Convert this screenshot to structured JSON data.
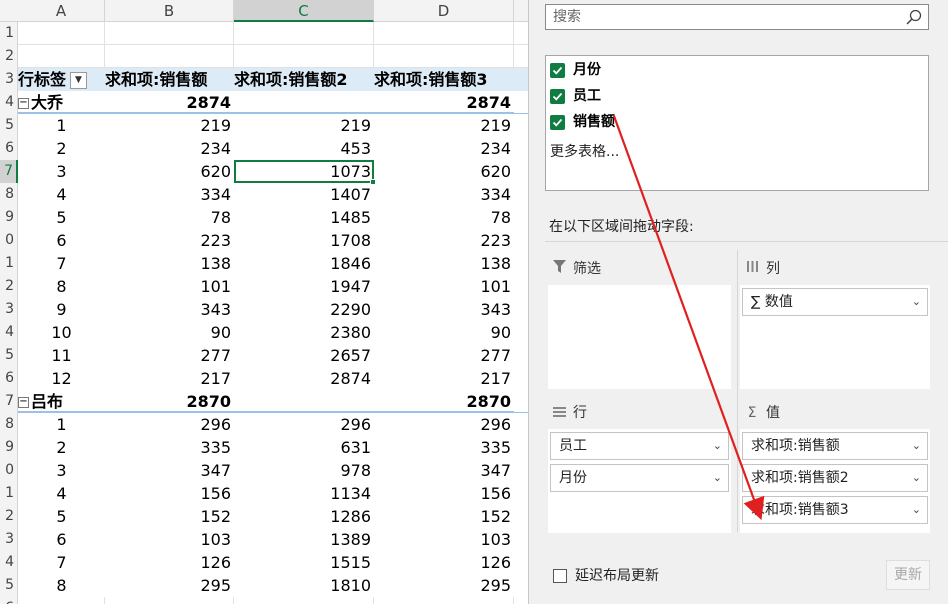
{
  "sheet": {
    "columns": [
      "A",
      "B",
      "C",
      "D"
    ],
    "selected_column": "C",
    "row_numbers": [
      "1",
      "2",
      "3",
      "4",
      "5",
      "6",
      "7",
      "8",
      "9",
      "0",
      "1",
      "2",
      "3",
      "4",
      "5",
      "6",
      "7",
      "8",
      "9",
      "0",
      "1",
      "2",
      "3",
      "4",
      "5",
      "6"
    ],
    "selected_row_index": 6,
    "header": {
      "row_label": "行标签",
      "col_b": "求和项:销售额",
      "col_c": "求和项:销售额2",
      "col_d": "求和项:销售额3"
    },
    "groups": [
      {
        "name": "大乔",
        "total_b": "2874",
        "total_d": "2874",
        "rows": [
          {
            "m": "1",
            "b": "219",
            "c": "219",
            "d": "219"
          },
          {
            "m": "2",
            "b": "234",
            "c": "453",
            "d": "234"
          },
          {
            "m": "3",
            "b": "620",
            "c": "1073",
            "d": "620"
          },
          {
            "m": "4",
            "b": "334",
            "c": "1407",
            "d": "334"
          },
          {
            "m": "5",
            "b": "78",
            "c": "1485",
            "d": "78"
          },
          {
            "m": "6",
            "b": "223",
            "c": "1708",
            "d": "223"
          },
          {
            "m": "7",
            "b": "138",
            "c": "1846",
            "d": "138"
          },
          {
            "m": "8",
            "b": "101",
            "c": "1947",
            "d": "101"
          },
          {
            "m": "9",
            "b": "343",
            "c": "2290",
            "d": "343"
          },
          {
            "m": "10",
            "b": "90",
            "c": "2380",
            "d": "90"
          },
          {
            "m": "11",
            "b": "277",
            "c": "2657",
            "d": "277"
          },
          {
            "m": "12",
            "b": "217",
            "c": "2874",
            "d": "217"
          }
        ]
      },
      {
        "name": "吕布",
        "total_b": "2870",
        "total_d": "2870",
        "rows": [
          {
            "m": "1",
            "b": "296",
            "c": "296",
            "d": "296"
          },
          {
            "m": "2",
            "b": "335",
            "c": "631",
            "d": "335"
          },
          {
            "m": "3",
            "b": "347",
            "c": "978",
            "d": "347"
          },
          {
            "m": "4",
            "b": "156",
            "c": "1134",
            "d": "156"
          },
          {
            "m": "5",
            "b": "152",
            "c": "1286",
            "d": "152"
          },
          {
            "m": "6",
            "b": "103",
            "c": "1389",
            "d": "103"
          },
          {
            "m": "7",
            "b": "126",
            "c": "1515",
            "d": "126"
          },
          {
            "m": "8",
            "b": "295",
            "c": "1810",
            "d": "295"
          }
        ]
      }
    ]
  },
  "pane": {
    "search_placeholder": "搜索",
    "fields": [
      "月份",
      "员工",
      "销售额"
    ],
    "more_tables": "更多表格...",
    "drag_label": "在以下区域间拖动字段:",
    "filter_label": "筛选",
    "columns_label": "列",
    "rows_label": "行",
    "values_label": "值",
    "columns_items": [
      "数值"
    ],
    "rows_items": [
      "员工",
      "月份"
    ],
    "values_items": [
      "求和项:销售额",
      "求和项:销售额2",
      "求和项:销售额3"
    ],
    "defer_label": "延迟布局更新",
    "update_label": "更新"
  },
  "colors": {
    "accent": "#107c41",
    "pivot_header": "#ddebf7",
    "arrow": "#e02020"
  }
}
